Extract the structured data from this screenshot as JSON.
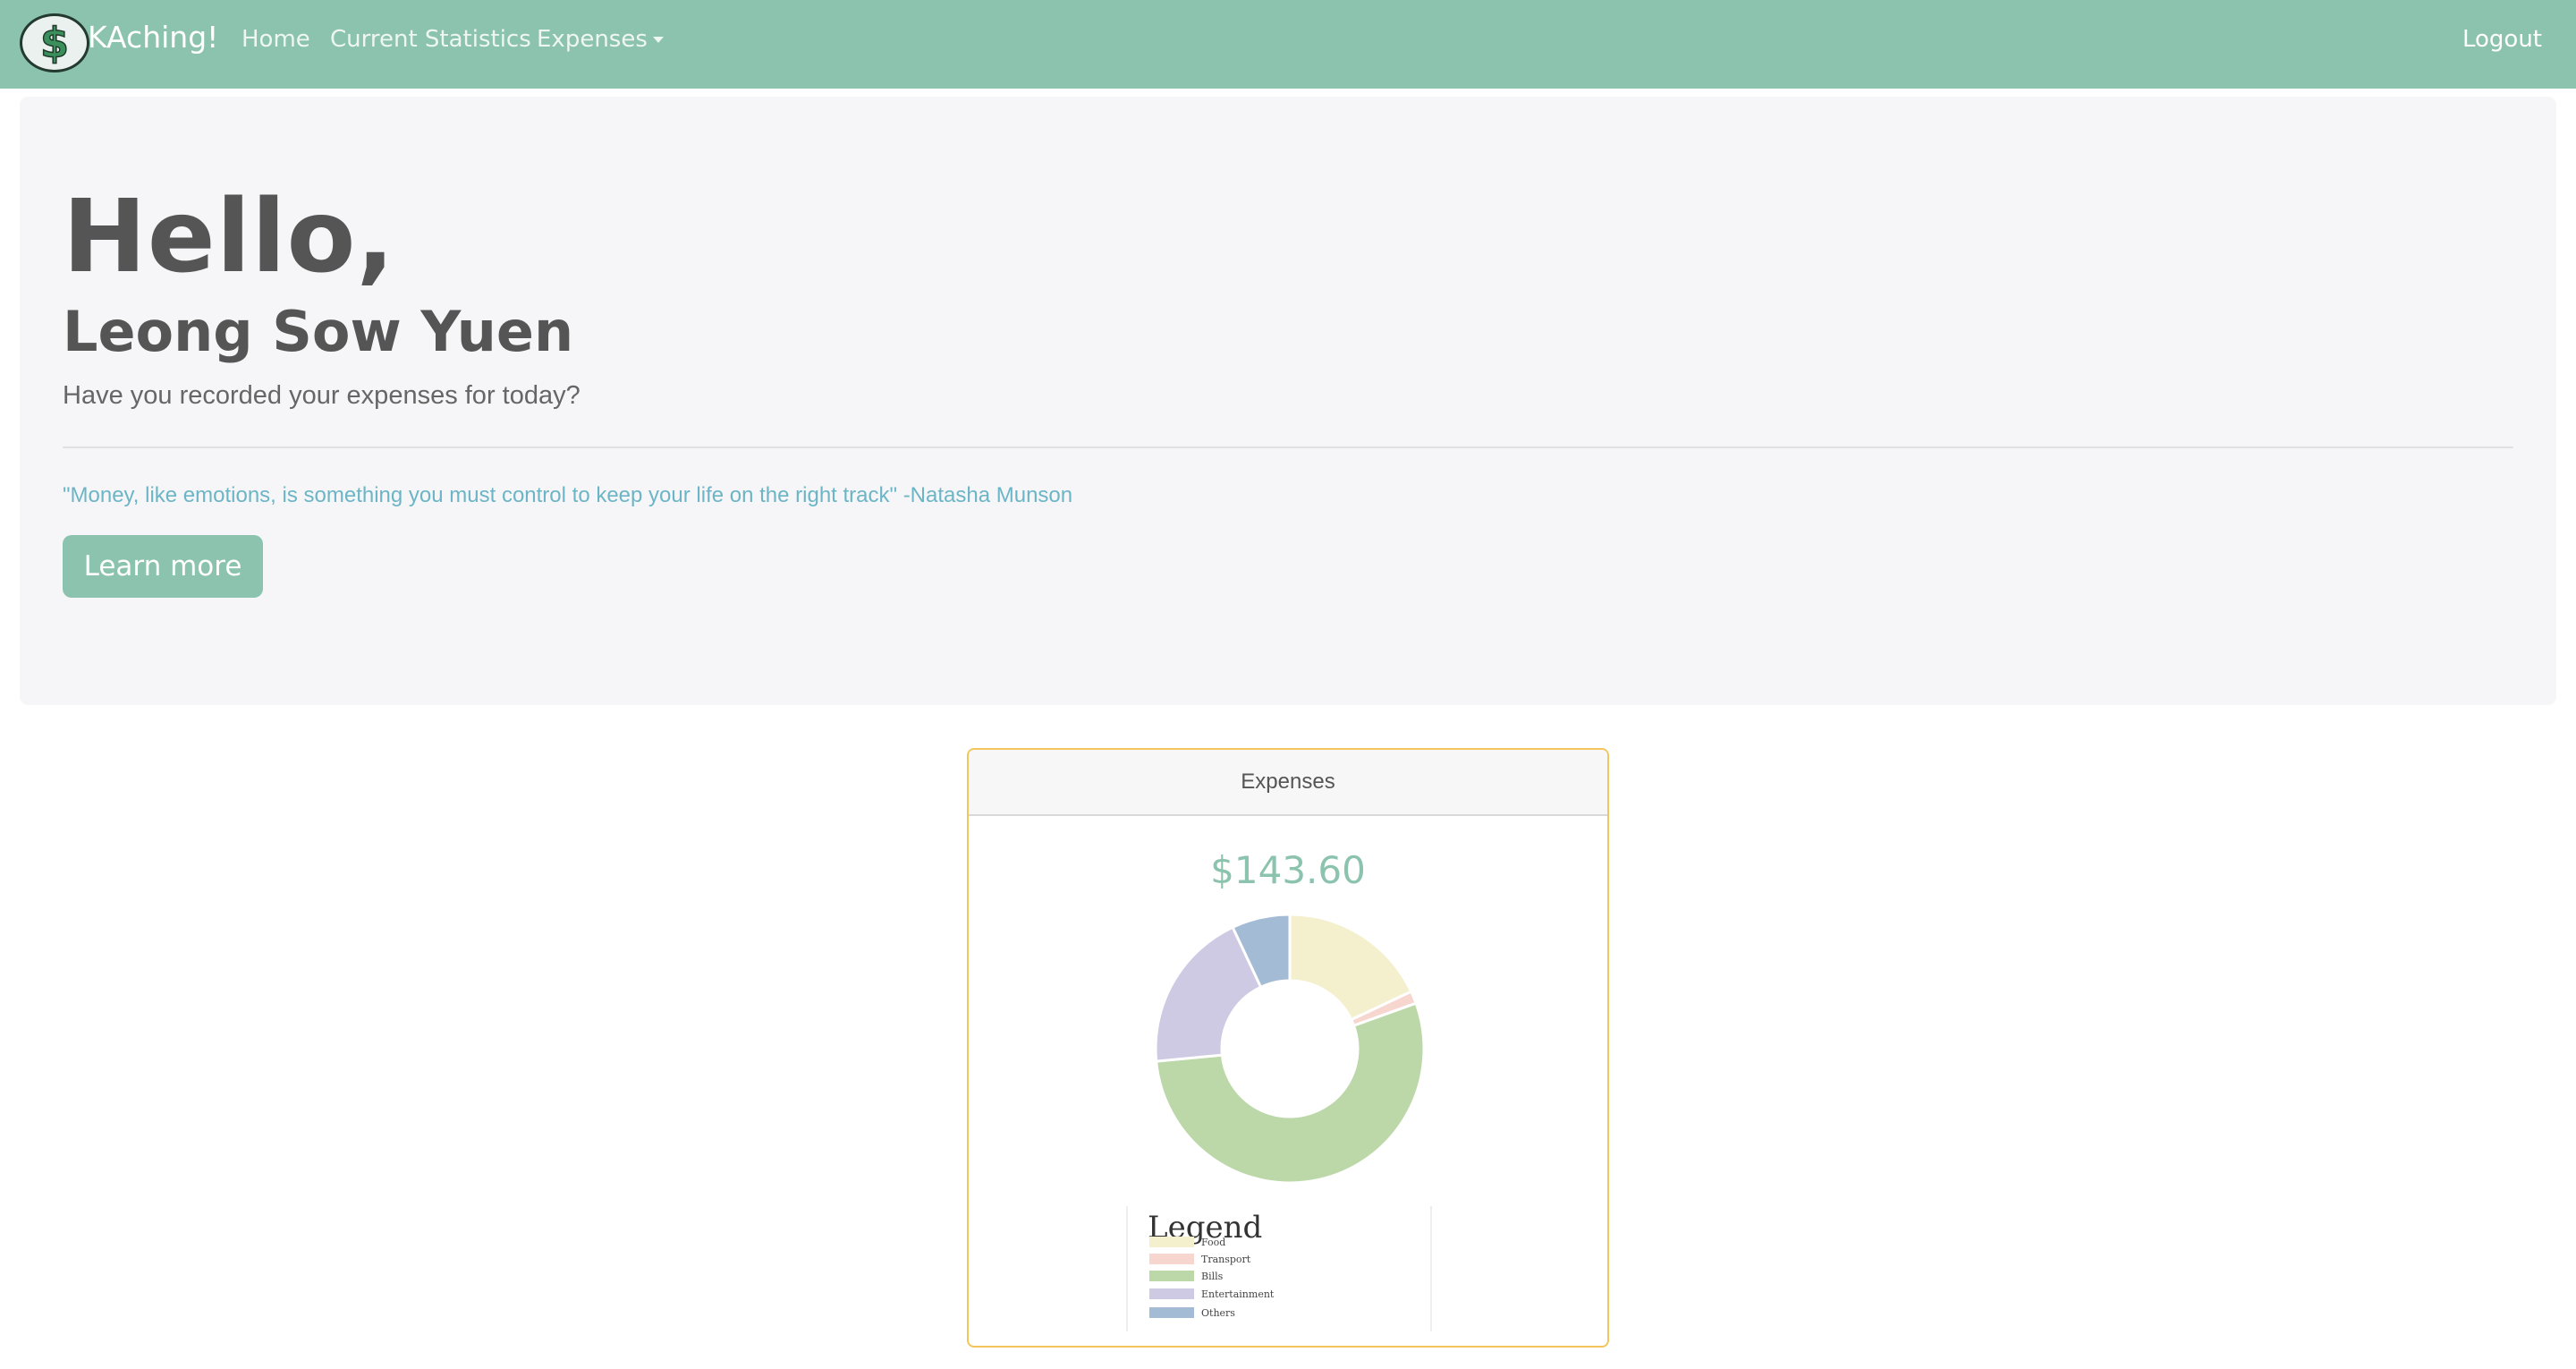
{
  "navbar": {
    "brand": "KAching!",
    "links": [
      "Home",
      "Current Statistics",
      "Expenses"
    ],
    "logout": "Logout",
    "logo_icon": "dollar-sign-icon"
  },
  "hero": {
    "greeting": "Hello,",
    "name": "Leong Sow Yuen",
    "prompt": "Have you recorded your expenses for today?",
    "quote": "\"Money, like emotions, is something you must control to keep your life on the right track\" -Natasha Munson",
    "button": "Learn more"
  },
  "card": {
    "header": "Expenses",
    "total": "$143.60"
  },
  "chart_data": {
    "type": "pie",
    "categories": [
      "Food",
      "Transport",
      "Bills",
      "Entertainment",
      "Others"
    ],
    "values": [
      18.0,
      1.5,
      54.0,
      19.5,
      7.0
    ],
    "colors": [
      "#f4efcd",
      "#f7d6d0",
      "#bcd8a8",
      "#cfcae3",
      "#a3bbd5"
    ],
    "legend_title": "Legend",
    "legend_placement": "bottom"
  },
  "colors": {
    "brand": "#8bc3ae",
    "card_border": "#f3c55c",
    "quote": "#6cb5c6"
  }
}
